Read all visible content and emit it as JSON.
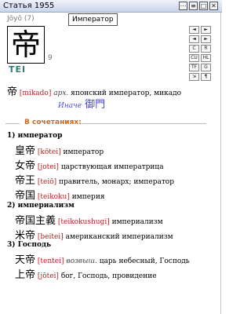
{
  "window": {
    "title": "Статья 1955"
  },
  "titlebar_buttons": [
    "⋯",
    "≡",
    "□",
    "✕"
  ],
  "header": {
    "jouyou": "Jōyō (7)",
    "tooltip": "Император",
    "kanji": "帝",
    "strokes": "9",
    "reading": "TEI"
  },
  "side_buttons": [
    [
      "◄",
      "►"
    ],
    [
      "◄",
      "►"
    ],
    [
      "C",
      "R"
    ],
    [
      "CU",
      "HL"
    ],
    [
      "TF",
      "G"
    ],
    [
      "⇲",
      "¶"
    ]
  ],
  "definition": {
    "kanji": "帝",
    "romaji": "[mikado]",
    "label": "арх.",
    "text": "японский император, микадо",
    "alt_label": "Иначе",
    "alt_kanji": "御門"
  },
  "section_title": "В сочетаниях:",
  "groups": [
    {
      "title": "1) император",
      "items": [
        {
          "word": "皇帝",
          "romaji": "[kōtei]",
          "meaning": "император"
        },
        {
          "word": "女帝",
          "romaji": "[jotei]",
          "meaning": "царствующая императрица"
        },
        {
          "word": "帝王",
          "romaji": "[teiō]",
          "meaning": "правитель, монарх;  император"
        },
        {
          "word": "帝国",
          "romaji": "[teikoku]",
          "meaning": "империя"
        }
      ]
    },
    {
      "title": "2) империализм",
      "items": [
        {
          "word": "帝国主義",
          "romaji": "[teikokushugi]",
          "meaning": "империализм"
        },
        {
          "word": "米帝",
          "romaji": "[beitei]",
          "meaning": "американский империализм"
        }
      ]
    },
    {
      "title": "3) Господь",
      "items": [
        {
          "word": "天帝",
          "romaji": "[tentei]",
          "label": "возвыш.",
          "meaning": "царь небесный, Господь"
        },
        {
          "word": "上帝",
          "romaji": "[jōtei]",
          "meaning": "бог, Господь, провидение"
        }
      ]
    }
  ]
}
